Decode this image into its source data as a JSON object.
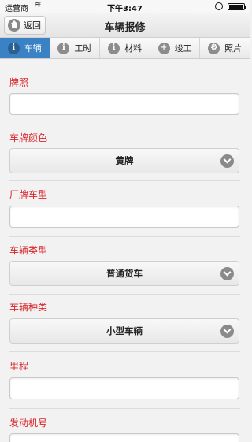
{
  "status_bar": {
    "carrier": "运营商",
    "time": "下午3:47"
  },
  "nav": {
    "back_label": "返回",
    "title": "车辆报修"
  },
  "tabs": [
    {
      "label": "车辆",
      "icon": "info-icon",
      "glyph": "i",
      "active": true
    },
    {
      "label": "工时",
      "icon": "info-icon",
      "glyph": "i",
      "active": false
    },
    {
      "label": "材料",
      "icon": "info-icon",
      "glyph": "i",
      "active": false
    },
    {
      "label": "竣工",
      "icon": "plus-icon",
      "glyph": "+",
      "active": false
    },
    {
      "label": "照片",
      "icon": "gear-icon",
      "glyph": "⚙",
      "active": false
    }
  ],
  "form": {
    "plate_label": "牌照",
    "plate_value": "",
    "plate_color_label": "车牌颜色",
    "plate_color_value": "黄牌",
    "model_label": "厂牌车型",
    "model_value": "",
    "vehicle_type_label": "车辆类型",
    "vehicle_type_value": "普通货车",
    "vehicle_kind_label": "车辆种类",
    "vehicle_kind_value": "小型车辆",
    "mileage_label": "里程",
    "mileage_value": "",
    "engine_no_label": "发动机号",
    "engine_no_value": ""
  },
  "colors": {
    "accent": "#3a82c4",
    "label_red": "#d9252a"
  }
}
